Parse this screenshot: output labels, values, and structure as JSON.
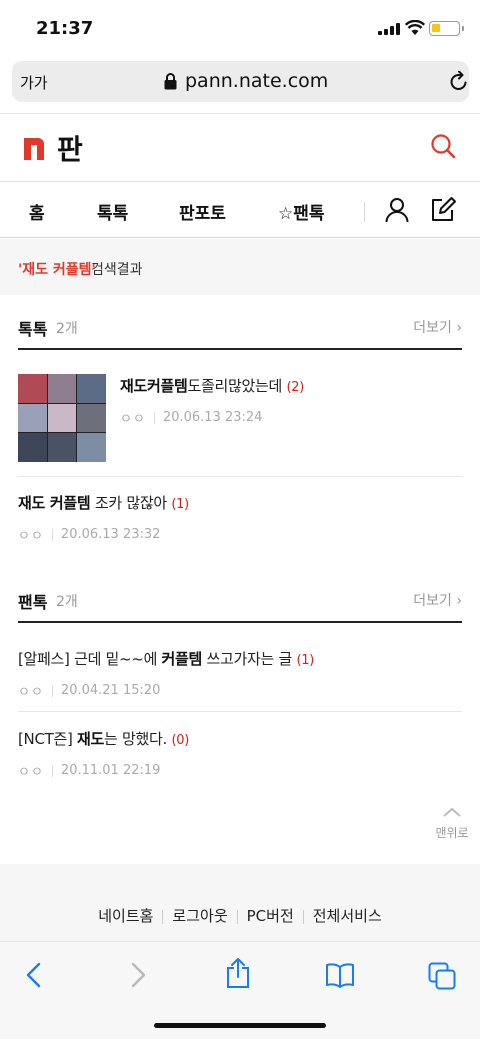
{
  "status_bar": {
    "time": "21:37",
    "battery_level": 0.35
  },
  "address_bar": {
    "text_size_label": "가가",
    "url": "pann.nate.com"
  },
  "site": {
    "logo_mark": "n",
    "logo_text": "판",
    "accent_color": "#e0392b"
  },
  "nav": {
    "items": [
      {
        "label": "홈"
      },
      {
        "label": "톡톡"
      },
      {
        "label": "판포토"
      },
      {
        "label": "☆팬톡"
      }
    ]
  },
  "search_result": {
    "keyword": "'재도 커플템'",
    "suffix": " 검색결과"
  },
  "sections": [
    {
      "title": "톡톡",
      "count": "2개",
      "more_label": "더보기",
      "posts": [
        {
          "title_bold": "재도커플템",
          "title_rest": "도졸리많았는데",
          "comments": "(2)",
          "author": "ㅇㅇ",
          "date": "20.06.13 23:24"
        },
        {
          "title_bold": "재도 커플템",
          "title_rest": " 조카 많잖아",
          "comments": "(1)",
          "author": "ㅇㅇ",
          "date": "20.06.13 23:32"
        }
      ]
    },
    {
      "title": "팬톡",
      "count": "2개",
      "more_label": "더보기",
      "posts": [
        {
          "title_pre": "[알페스] 근데 밑~~에 ",
          "title_bold": "커플템",
          "title_rest": " 쓰고가자는 글",
          "comments": "(1)",
          "author": "ㅇㅇ",
          "date": "20.04.21 15:20"
        },
        {
          "title_pre": "[NCT즌] ",
          "title_bold": "재도",
          "title_rest": "는 망했다.",
          "comments": "(0)",
          "author": "ㅇㅇ",
          "date": "20.11.01 22:19"
        }
      ]
    }
  ],
  "top_button": {
    "label": "맨위로"
  },
  "footer": {
    "links": [
      "네이트홈",
      "로그아웃",
      "PC버전",
      "전체서비스"
    ]
  }
}
